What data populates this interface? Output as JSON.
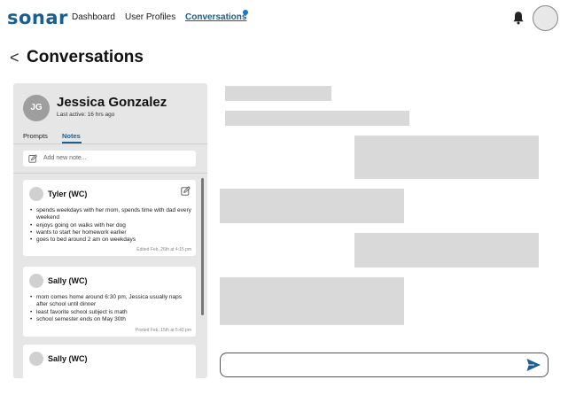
{
  "nav": {
    "logo": "sonar",
    "links": [
      "Dashboard",
      "User Profiles",
      "Conversations"
    ],
    "active_link": "Conversations",
    "accent": "#1a5f8e",
    "notification_dot_color": "#1976d2"
  },
  "page": {
    "back_symbol": "<",
    "title": "Conversations"
  },
  "profile": {
    "initials": "JG",
    "name": "Jessica Gonzalez",
    "last_active": "Last active: 16 hrs ago",
    "tabs": [
      "Prompts",
      "Notes"
    ],
    "active_tab": "Notes"
  },
  "notes": {
    "add_placeholder": "Add new note...",
    "items": [
      {
        "author": "Tyler (WC)",
        "lines": [
          "spends weekdays with her mom, spends time with dad every weekend",
          "enjoys going on walks with her dog",
          "wants to start her homework earlier",
          "goes to bed around 2 am on weekdays"
        ],
        "meta": "Edited Feb. 26th at 4:15 pm"
      },
      {
        "author": "Sally (WC)",
        "lines": [
          "mom comes home around 6:30 pm, Jessica usually naps after school until dinner",
          "least favorite school subject is math",
          "school semester ends on May 30th"
        ],
        "meta": "Posted Feb. 15th at 5:42 pm"
      },
      {
        "author": "Sally (WC)",
        "lines": [],
        "meta": ""
      }
    ]
  },
  "chat": {
    "input_value": "",
    "placeholder_color": "#d9d9d9"
  }
}
